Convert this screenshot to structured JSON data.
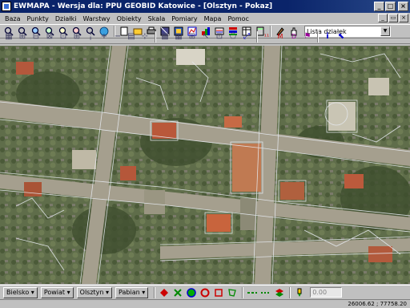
{
  "window": {
    "title": "EWMAPA - Wersja dla: PPU GEOBID Katowice - [Olsztyn - Pokaz]"
  },
  "menu": [
    "Baza",
    "Punkty",
    "Działki",
    "Warstwy",
    "Obiekty",
    "Skala",
    "Pomiary",
    "Mapa",
    "Pomoc"
  ],
  "toolbar": {
    "combo_value": "Lista działek",
    "icons_row1": [
      "zoom-in-icon",
      "zoom-out-icon",
      "zoom-window-icon",
      "zoom-prev-icon",
      "zoom-next-icon",
      "zoom-all-icon",
      "zoom-extents-icon",
      "refresh-icon",
      "new-icon",
      "open-icon",
      "print-icon",
      "layers-icon",
      "raster-icon",
      "vector-icon",
      "palette-icon",
      "edit-icon",
      "flags-icon",
      "table-icon",
      "calc-icon",
      "tools-icon",
      "hand-icon"
    ],
    "icons_row2": [
      "pointer-icon",
      "point-icon",
      "line-icon",
      "plus-icon",
      "minus-icon",
      "grid-icon",
      "grid-icon-2",
      "cut-icon",
      "insert-icon",
      "check-icon",
      "angle-icon",
      "dim1-icon",
      "dim2-icon",
      "dim3-icon",
      "info-icon",
      "pointer2-icon"
    ]
  },
  "bottom": {
    "dropdowns": [
      "Bielsko",
      "Powiat",
      "Olsztyn",
      "Pabian"
    ],
    "field_value": "0.00"
  },
  "status": {
    "coords": "26006.62 ; 77758.20"
  }
}
